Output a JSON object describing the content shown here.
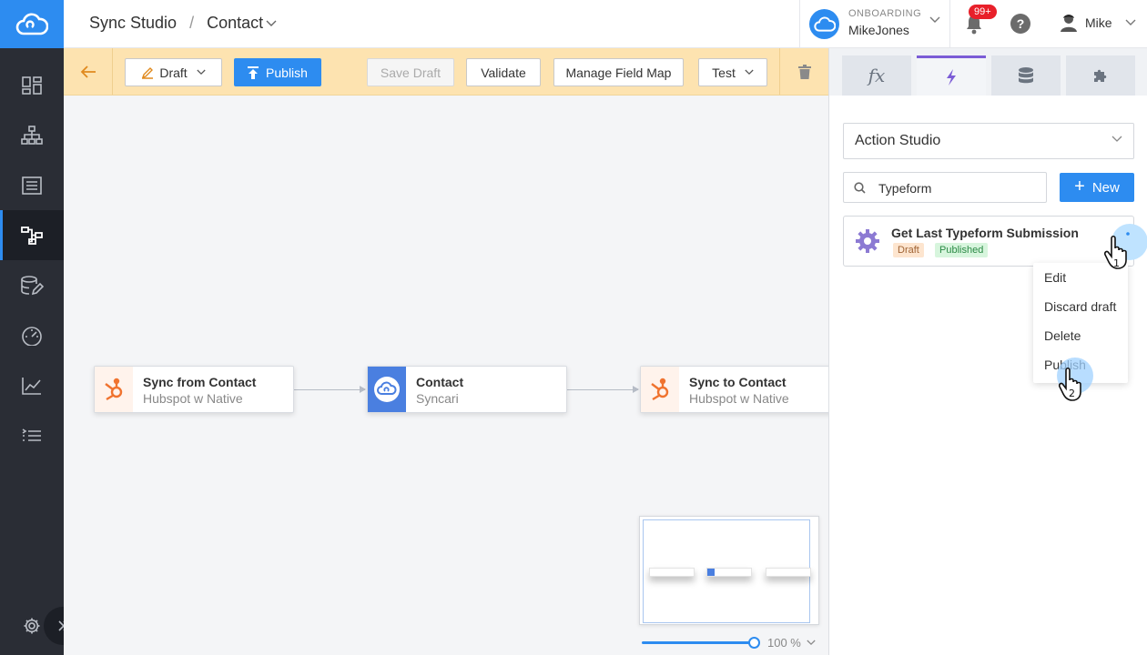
{
  "header": {
    "breadcrumb_root": "Sync Studio",
    "breadcrumb_sep": "/",
    "breadcrumb_current": "Contact",
    "onboarding_label": "ONBOARDING",
    "onboarding_name": "MikeJones",
    "notifications_badge": "99+",
    "help": "?",
    "user_name": "Mike"
  },
  "toolbar": {
    "draft": "Draft",
    "publish": "Publish",
    "save_draft": "Save Draft",
    "validate": "Validate",
    "manage_field_map": "Manage Field Map",
    "test": "Test"
  },
  "canvas": {
    "nodes": [
      {
        "title": "Sync from Contact",
        "subtitle": "Hubspot w Native",
        "icon": "hubspot-icon"
      },
      {
        "title": "Contact",
        "subtitle": "Syncari",
        "icon": "syncari-cloud-icon"
      },
      {
        "title": "Sync to Contact",
        "subtitle": "Hubspot w Native",
        "icon": "hubspot-icon"
      }
    ],
    "zoom_level": "100 %"
  },
  "right_panel": {
    "tabs": [
      {
        "label": "fx",
        "icon": "function-icon"
      },
      {
        "label": "",
        "icon": "lightning-icon"
      },
      {
        "label": "",
        "icon": "database-icon"
      },
      {
        "label": "",
        "icon": "puzzle-icon"
      }
    ],
    "active_tab": 1,
    "studio_select": "Action Studio",
    "search_value": "Typeform",
    "new_button": "New",
    "card": {
      "title": "Get Last Typeform Submission",
      "tags": [
        "Draft",
        "Published"
      ]
    },
    "menu": [
      "Edit",
      "Discard draft",
      "Delete",
      "Publish"
    ]
  },
  "annotations": {
    "step1": "1",
    "step2": "2"
  },
  "colors": {
    "primary": "#2d8cf0",
    "nav_bg": "#2a2d35",
    "toolbar_bg": "#fde3b0",
    "active_tab_accent": "#7b5cd6",
    "badge": "#e8202a"
  }
}
